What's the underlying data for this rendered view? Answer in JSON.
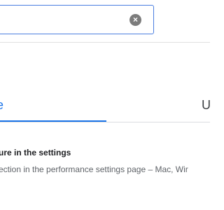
{
  "search": {
    "value": "",
    "placeholder": "",
    "clear_icon": "×"
  },
  "tabs": [
    {
      "label": "e",
      "active": true
    },
    {
      "label": "U",
      "active": false
    }
  ],
  "result": {
    "title": "ure in the settings",
    "description": "ection in the performance settings page – Mac, Wir"
  },
  "colors": {
    "accent": "#1a73e8",
    "border_focus": "#4a7ee0",
    "text_primary": "#202124",
    "text_secondary": "#5f6368"
  }
}
